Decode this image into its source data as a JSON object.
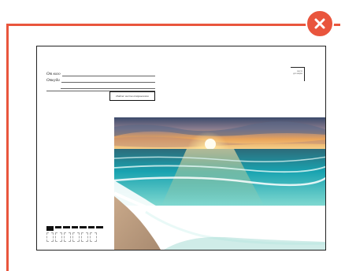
{
  "envelope": {
    "from_label": "От кого",
    "where_from_label": "Откуда",
    "index_box_text": "Индекс места отправления",
    "stamp_text": [
      "место",
      "для марки"
    ]
  },
  "close_button": {
    "icon": "close-icon"
  },
  "colors": {
    "accent": "#e9553d"
  }
}
